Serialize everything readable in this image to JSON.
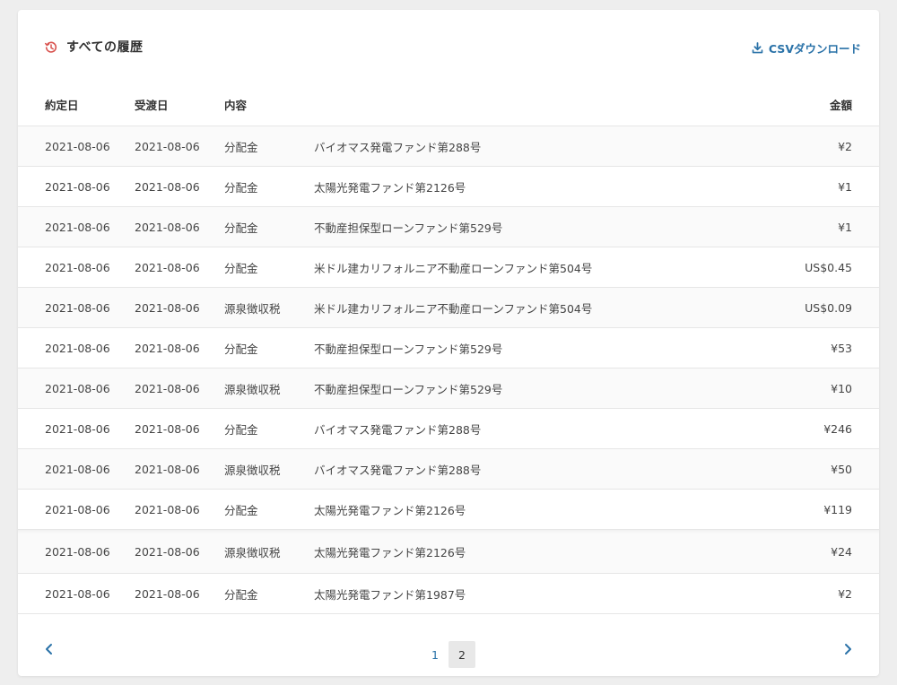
{
  "header": {
    "title": "すべての履歴",
    "csv_label": "CSVダウンロード"
  },
  "columns": {
    "contract_date": "約定日",
    "delivery_date": "受渡日",
    "content": "内容",
    "amount": "金額"
  },
  "rows": [
    {
      "d1": "2021-08-06",
      "d2": "2021-08-06",
      "type": "分配金",
      "name": "バイオマス発電ファンド第288号",
      "amount": "¥2"
    },
    {
      "d1": "2021-08-06",
      "d2": "2021-08-06",
      "type": "分配金",
      "name": "太陽光発電ファンド第2126号",
      "amount": "¥1"
    },
    {
      "d1": "2021-08-06",
      "d2": "2021-08-06",
      "type": "分配金",
      "name": "不動産担保型ローンファンド第529号",
      "amount": "¥1"
    },
    {
      "d1": "2021-08-06",
      "d2": "2021-08-06",
      "type": "分配金",
      "name": "米ドル建カリフォルニア不動産ローンファンド第504号",
      "amount": "US$0.45"
    },
    {
      "d1": "2021-08-06",
      "d2": "2021-08-06",
      "type": "源泉徴収税",
      "name": "米ドル建カリフォルニア不動産ローンファンド第504号",
      "amount": "US$0.09"
    },
    {
      "d1": "2021-08-06",
      "d2": "2021-08-06",
      "type": "分配金",
      "name": "不動産担保型ローンファンド第529号",
      "amount": "¥53"
    },
    {
      "d1": "2021-08-06",
      "d2": "2021-08-06",
      "type": "源泉徴収税",
      "name": "不動産担保型ローンファンド第529号",
      "amount": "¥10"
    },
    {
      "d1": "2021-08-06",
      "d2": "2021-08-06",
      "type": "分配金",
      "name": "バイオマス発電ファンド第288号",
      "amount": "¥246"
    },
    {
      "d1": "2021-08-06",
      "d2": "2021-08-06",
      "type": "源泉徴収税",
      "name": "バイオマス発電ファンド第288号",
      "amount": "¥50"
    },
    {
      "d1": "2021-08-06",
      "d2": "2021-08-06",
      "type": "分配金",
      "name": "太陽光発電ファンド第2126号",
      "amount": "¥119"
    },
    {
      "d1": "2021-08-06",
      "d2": "2021-08-06",
      "type": "源泉徴収税",
      "name": "太陽光発電ファンド第2126号",
      "amount": "¥24"
    },
    {
      "d1": "2021-08-06",
      "d2": "2021-08-06",
      "type": "分配金",
      "name": "太陽光発電ファンド第1987号",
      "amount": "¥2"
    }
  ],
  "pagination": {
    "pages": [
      "1",
      "2"
    ],
    "current": "2"
  },
  "colors": {
    "accent": "#2a72a8",
    "history_icon": "#d9534f"
  },
  "icons": {
    "title": "history-icon",
    "csv": "download-icon",
    "prev": "chevron-left-icon",
    "next": "chevron-right-icon"
  }
}
